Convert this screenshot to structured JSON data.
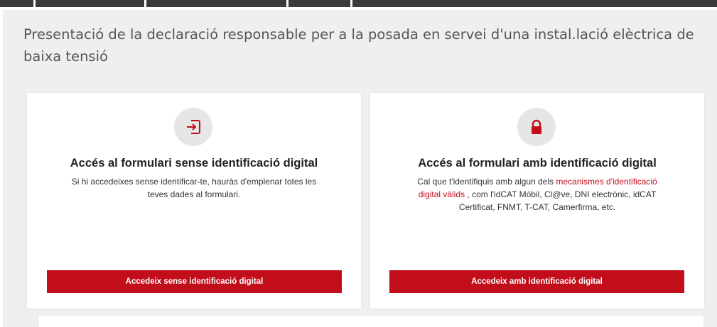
{
  "page": {
    "title": "Presentació de la declaració responsable per a la posada en servei d'una instal.lació elèctrica de baixa tensió"
  },
  "cards": {
    "no_id": {
      "icon": "login-enter-icon",
      "title": "Accés al formulari sense identificació digital",
      "description_line1": "Si hi accedeixes sense identificar-te, hauràs d'emplenar totes les",
      "description_line2": "teves dades al formulari.",
      "button_label": "Accedeix sense identificació digital"
    },
    "with_id": {
      "icon": "padlock-icon",
      "title": "Accés al formulari amb identificació digital",
      "description_part1": "Cal que t'identifiquis amb algun dels ",
      "description_link_a": "mecanismes d'identificació",
      "description_link_b": "digital vàlids",
      "description_part2": " , com l'idCAT Mòbil, Cl@ve, DNI electrònic, idCAT",
      "description_line3": "Certificat, FNMT, T-CAT, Camerfirma, etc.",
      "button_label": "Accedeix amb identificació digital"
    }
  },
  "colors": {
    "accent": "#c20e1a",
    "panel_background": "#efefef",
    "icon_circle": "#e6e6e6"
  }
}
